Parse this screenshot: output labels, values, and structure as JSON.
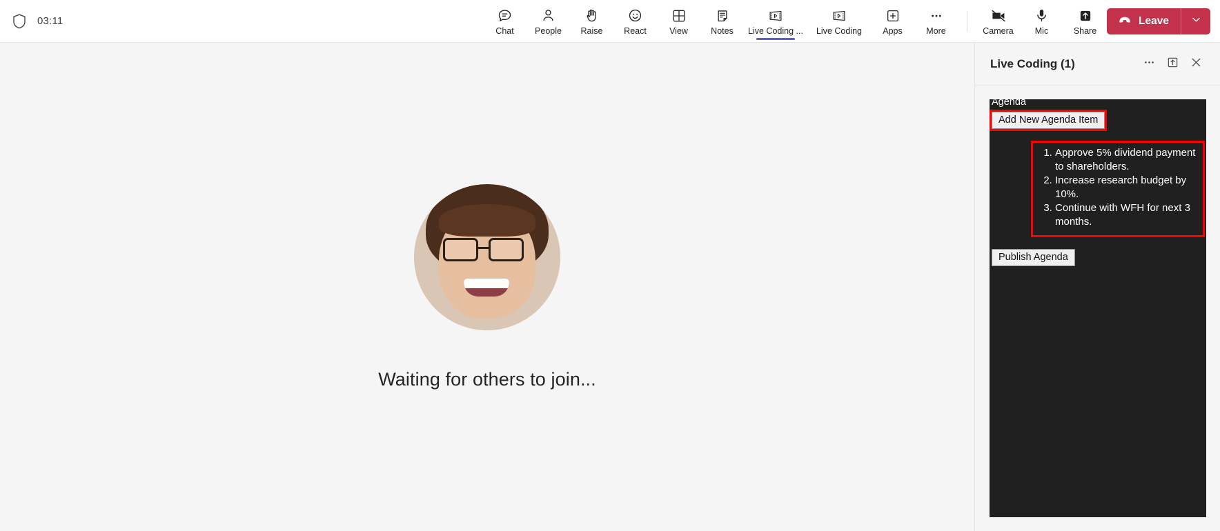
{
  "topbar": {
    "shield_icon": "shield-icon",
    "clock": "03:11",
    "tools": [
      {
        "icon": "chat-icon",
        "label": "Chat",
        "active": false
      },
      {
        "icon": "people-icon",
        "label": "People",
        "active": false
      },
      {
        "icon": "raise-hand-icon",
        "label": "Raise",
        "active": false
      },
      {
        "icon": "react-icon",
        "label": "React",
        "active": false
      },
      {
        "icon": "view-grid-icon",
        "label": "View",
        "active": false
      },
      {
        "icon": "notes-icon",
        "label": "Notes",
        "active": false
      },
      {
        "icon": "live-coding-icon",
        "label": "Live Coding ...",
        "active": true
      },
      {
        "icon": "live-coding-icon",
        "label": "Live Coding",
        "active": false
      },
      {
        "icon": "apps-plus-icon",
        "label": "Apps",
        "active": false
      },
      {
        "icon": "more-ellipsis-icon",
        "label": "More",
        "active": false
      }
    ],
    "devices": [
      {
        "icon": "camera-off-icon",
        "label": "Camera"
      },
      {
        "icon": "mic-icon",
        "label": "Mic"
      },
      {
        "icon": "share-icon",
        "label": "Share"
      }
    ],
    "leave": {
      "label": "Leave",
      "icon": "hangup-icon",
      "caret_icon": "chevron-down-icon",
      "color": "#c4314b"
    }
  },
  "stage": {
    "avatar": "participant-avatar",
    "caption": "Waiting for others to join..."
  },
  "panel": {
    "title": "Live Coding (1)",
    "more_icon": "more-ellipsis-icon",
    "popout_icon": "popout-icon",
    "close_icon": "close-icon",
    "app": {
      "heading": "Agenda",
      "add_button": "Add New Agenda Item",
      "publish_button": "Publish Agenda",
      "items": [
        "Approve 5% dividend payment to shareholders.",
        "Increase research budget by 10%.",
        "Continue with WFH for next 3 months."
      ],
      "highlight_color": "#ff0000",
      "background": "#202020"
    }
  }
}
